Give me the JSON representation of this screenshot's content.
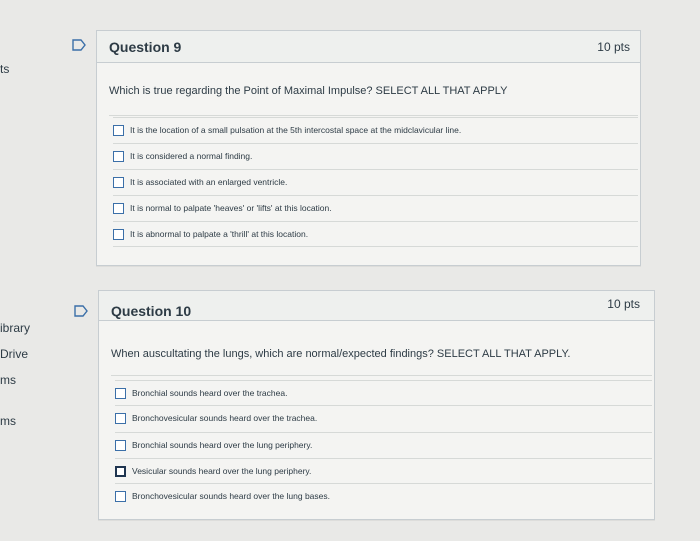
{
  "sidebar": {
    "items": [
      {
        "label": "ts"
      },
      {
        "label": "ibrary"
      },
      {
        "label": "Drive"
      },
      {
        "label": "ms"
      },
      {
        "label": "ms"
      }
    ]
  },
  "questions": [
    {
      "title": "Question 9",
      "points": "10 pts",
      "prompt": "Which is true regarding the Point of Maximal Impulse? SELECT ALL THAT APPLY",
      "answers": [
        {
          "label": "It is the location of a small pulsation at the 5th intercostal space at the midclavicular line."
        },
        {
          "label": "It is considered a normal finding."
        },
        {
          "label": "It is associated with an enlarged ventricle."
        },
        {
          "label": "It is normal to palpate 'heaves' or 'lifts' at this location."
        },
        {
          "label": "It is abnormal to palpate a 'thrill' at this location."
        }
      ]
    },
    {
      "title": "Question 10",
      "points": "10 pts",
      "prompt": "When auscultating the lungs, which are normal/expected findings? SELECT ALL THAT APPLY.",
      "answers": [
        {
          "label": "Bronchial sounds heard over the trachea."
        },
        {
          "label": "Bronchovesicular sounds heard over the trachea."
        },
        {
          "label": "Bronchial sounds heard over the lung periphery."
        },
        {
          "label": "Vesicular sounds heard over the lung periphery."
        },
        {
          "label": "Bronchovesicular sounds heard over the lung bases."
        }
      ]
    }
  ]
}
